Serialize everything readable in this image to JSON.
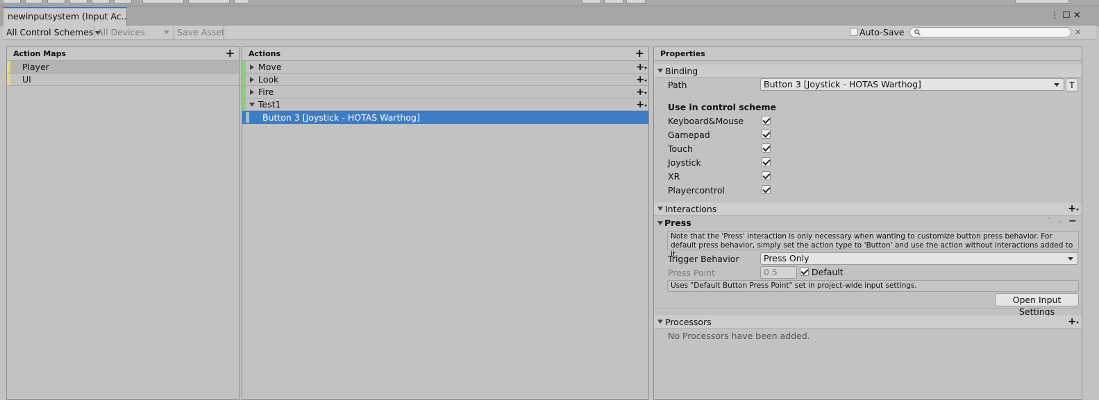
{
  "window": {
    "tab_title": "newinputsystem (Input Ac..."
  },
  "toolbar": {
    "control_schemes": "All Control Schemes",
    "devices": "All Devices",
    "save_asset": "Save Asset",
    "auto_save": "Auto-Save",
    "auto_save_checked": false,
    "search_value": ""
  },
  "action_maps": {
    "header": "Action Maps",
    "items": [
      {
        "label": "Player",
        "selected": true
      },
      {
        "label": "UI",
        "selected": false
      }
    ]
  },
  "actions": {
    "header": "Actions",
    "items": [
      {
        "label": "Move",
        "expanded": false
      },
      {
        "label": "Look",
        "expanded": false
      },
      {
        "label": "Fire",
        "expanded": false
      },
      {
        "label": "Test1",
        "expanded": true
      }
    ],
    "binding": "Button 3 [Joystick - HOTAS Warthog]"
  },
  "properties": {
    "header": "Properties",
    "binding_section": "Binding",
    "path_label": "Path",
    "path_value": "Button 3 [Joystick - HOTAS Warthog]",
    "t_button": "T",
    "use_in_scheme": "Use in control scheme",
    "schemes": [
      {
        "label": "Keyboard&Mouse",
        "checked": true
      },
      {
        "label": "Gamepad",
        "checked": true
      },
      {
        "label": "Touch",
        "checked": true
      },
      {
        "label": "Joystick",
        "checked": true
      },
      {
        "label": "XR",
        "checked": true
      },
      {
        "label": "Playercontrol",
        "checked": true
      }
    ],
    "interactions_section": "Interactions",
    "press_section": "Press",
    "press_note": "Note that the 'Press' interaction is only necessary when wanting to customize button press behavior. For default press behavior, simply set the action type to 'Button' and use the action without interactions added to it.",
    "trigger_label": "Trigger Behavior",
    "trigger_value": "Press Only",
    "press_point_label": "Press Point",
    "press_point_value": "0.5",
    "default_label": "Default",
    "press_point_note": "Uses \"Default Button Press Point\" set in project-wide input settings.",
    "open_settings": "Open Input Settings",
    "processors_section": "Processors",
    "no_processors": "No Processors have been added."
  },
  "colors": {
    "selection": "#3e7cc3",
    "map_stripe": "#e9d877",
    "action_stripe": "#8ccf7c",
    "background": "#c2c2c2"
  }
}
